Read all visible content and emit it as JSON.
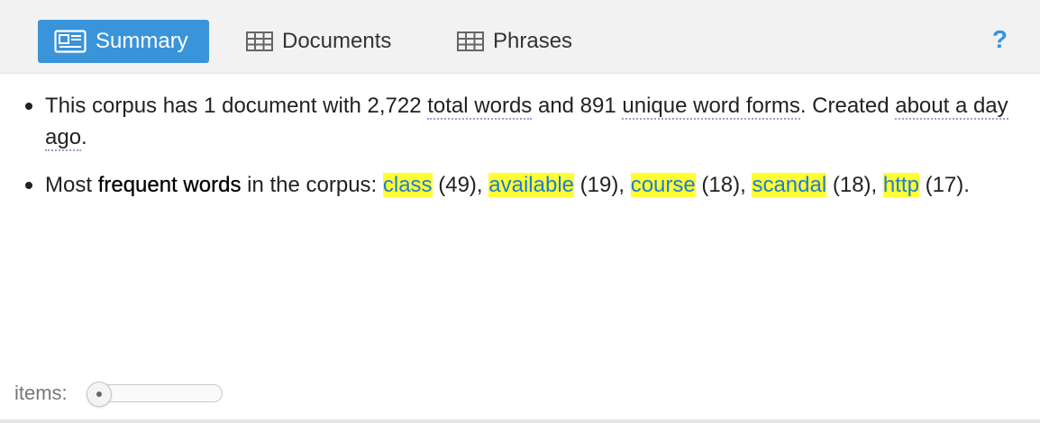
{
  "tabs": {
    "summary": "Summary",
    "documents": "Documents",
    "phrases": "Phrases"
  },
  "help": {
    "label": "?"
  },
  "summary": {
    "line1": {
      "prefix": "This corpus has 1 document with 2,722 ",
      "total_words": "total words",
      "mid": " and 891 ",
      "unique_forms": "unique word forms",
      "suffix": ". Created ",
      "created": "about a day ago",
      "end": "."
    },
    "line2": {
      "prefix": "Most ",
      "bold": "frequent words",
      "mid": " in the corpus: ",
      "words": [
        {
          "term": "class",
          "count": "(49)",
          "sep": ", "
        },
        {
          "term": "available",
          "count": "(19)",
          "sep": ", "
        },
        {
          "term": "course",
          "count": "(18)",
          "sep": ", "
        },
        {
          "term": "scandal",
          "count": "(18)",
          "sep": ", "
        },
        {
          "term": "http",
          "count": "(17)",
          "sep": "."
        }
      ]
    }
  },
  "footer": {
    "items_label": "items:"
  },
  "slider": {
    "value_fraction": 0
  },
  "colors": {
    "accent": "#3a94d9",
    "highlight": "#ffff33",
    "term_text": "#1f7cd4"
  }
}
